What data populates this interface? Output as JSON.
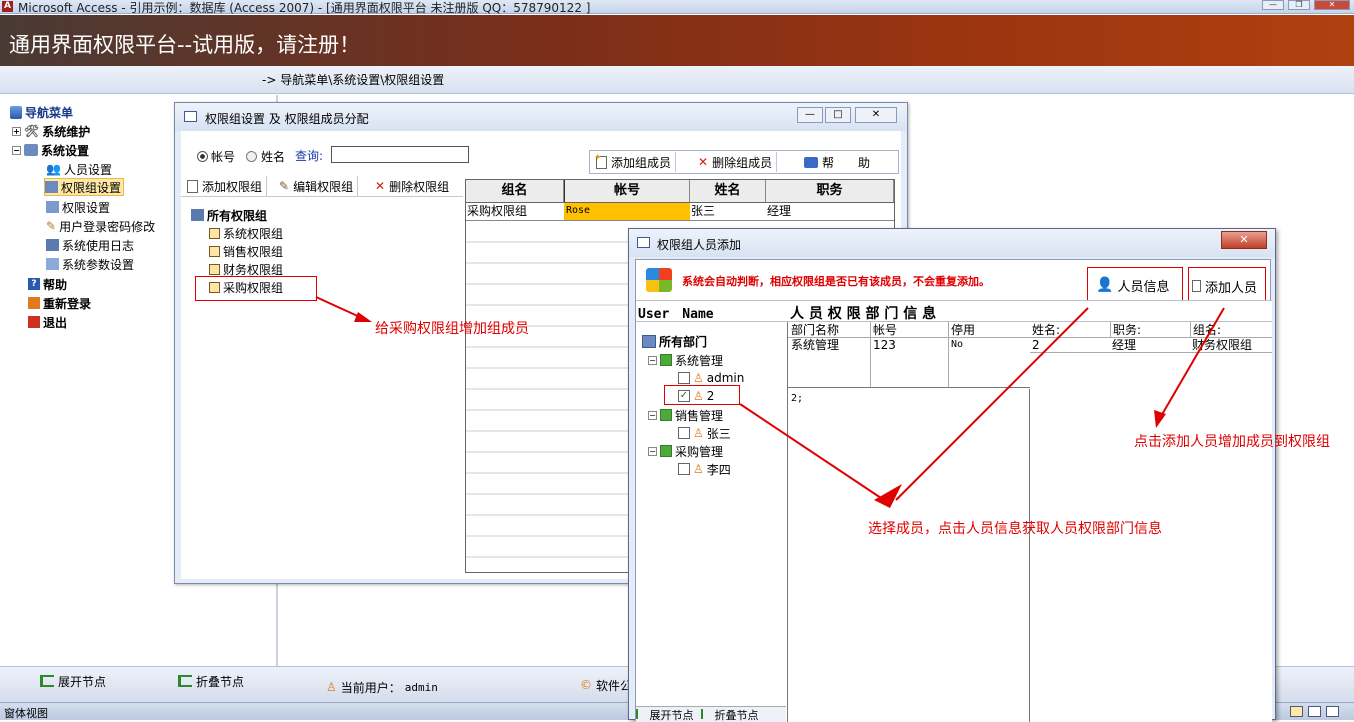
{
  "title_bar": {
    "text": "Microsoft Access - 引用示例：数据库 (Access 2007) - [通用界面权限平台  未注册版 QQ：578790122 ]"
  },
  "banner": {
    "text": "通用界面权限平台--试用版，请注册！"
  },
  "breadcrumb": {
    "text": "-> 导航菜单\\系统设置\\权限组设置"
  },
  "nav": {
    "root": "导航菜单",
    "maint": "系统维护",
    "settings": "系统设置",
    "items": [
      "人员设置",
      "权限组设置",
      "权限设置",
      "用户登录密码修改",
      "系统使用日志",
      "系统参数设置"
    ],
    "help": "帮助",
    "relogin": "重新登录",
    "exit": "退出"
  },
  "bottom": {
    "expand": "展开节点",
    "collapse": "折叠节点",
    "current_user_label": "当前用户：",
    "current_user": "admin",
    "software": "软件公"
  },
  "status": {
    "text": "窗体视图"
  },
  "dialog1": {
    "title": "权限组设置 及 权限组成员分配",
    "radio_account": "帐号",
    "radio_name": "姓名",
    "query_label": "查询:",
    "search_value": "",
    "add_member": "添加组成员",
    "del_member": "删除组成员",
    "help_label": "帮　　助",
    "add_group": "添加权限组",
    "edit_group": "编辑权限组",
    "del_group": "删除权限组",
    "tree_root": "所有权限组",
    "groups": [
      "系统权限组",
      "销售权限组",
      "财务权限组",
      "采购权限组"
    ],
    "table_headers": [
      "组名",
      "帐号",
      "姓名",
      "职务"
    ],
    "table_row": [
      "采购权限组",
      "Rose",
      "张三",
      "经理"
    ]
  },
  "dialog2": {
    "title": "权限组人员添加",
    "notice": "系统会自动判断，相应权限组是否已有该成员，不会重复添加。",
    "btn_info": "人员信息",
    "btn_add": "添加人员",
    "user_name_hdr": "User　Name",
    "info_hdr": "人 员 权 限 部 门 信 息",
    "tree_root": "所有部门",
    "depts": [
      {
        "name": "系统管理",
        "users": [
          "admin",
          "2"
        ]
      },
      {
        "name": "销售管理",
        "users": [
          "张三"
        ]
      },
      {
        "name": "采购管理",
        "users": [
          "李四"
        ]
      }
    ],
    "dept_headers": [
      "部门名称",
      "帐号",
      "停用"
    ],
    "dept_row": [
      "系统管理",
      "123",
      "No"
    ],
    "group_headers": [
      "姓名:",
      "职务:",
      "组名:"
    ],
    "group_row": [
      "2",
      "经理",
      "财务权限组"
    ],
    "memo": "2;",
    "footer_left": "展开节点",
    "footer_right": "折叠节点"
  },
  "annotations": {
    "a1": "给采购权限组增加组成员",
    "a2": "点击添加人员增加成员到权限组",
    "a3": "选择成员，点击人员信息获取人员权限部门信息"
  },
  "colors": {
    "banner": "#8a2e14",
    "accent_red": "#e00000",
    "highlight": "#ffc000"
  }
}
